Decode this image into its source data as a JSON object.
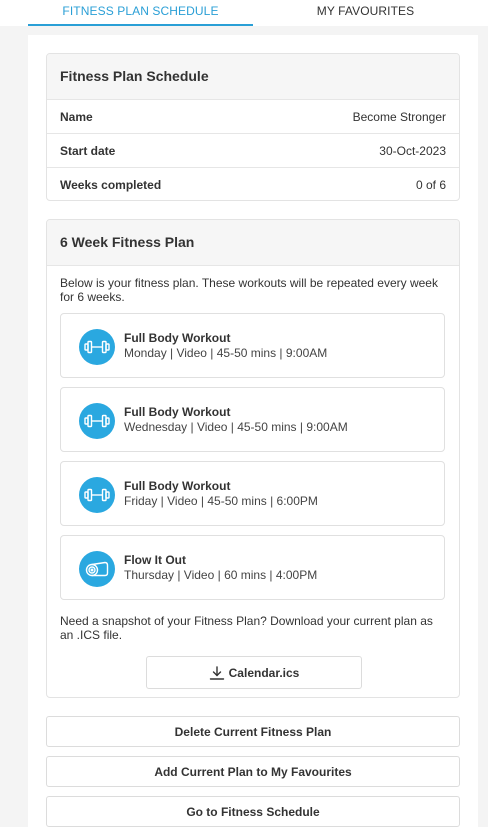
{
  "tabs": [
    {
      "label": "FITNESS PLAN SCHEDULE"
    },
    {
      "label": "MY FAVOURITES"
    }
  ],
  "schedule": {
    "title": "Fitness Plan Schedule",
    "rows": [
      {
        "key": "Name",
        "value": "Become Stronger"
      },
      {
        "key": "Start date",
        "value": "30-Oct-2023"
      },
      {
        "key": "Weeks completed",
        "value": "0 of 6"
      }
    ]
  },
  "plan": {
    "title": "6 Week Fitness Plan",
    "description": "Below is your fitness plan. These workouts will be repeated every week for 6 weeks.",
    "workouts": [
      {
        "title": "Full Body Workout",
        "details": "Monday | Video | 45-50 mins | 9:00AM",
        "icon": "dumbbell-icon"
      },
      {
        "title": "Full Body Workout",
        "details": "Wednesday | Video | 45-50 mins | 9:00AM",
        "icon": "dumbbell-icon"
      },
      {
        "title": "Full Body Workout",
        "details": "Friday | Video | 45-50 mins | 6:00PM",
        "icon": "dumbbell-icon"
      },
      {
        "title": "Flow It Out",
        "details": "Thursday | Video | 60 mins | 4:00PM",
        "icon": "yoga-mat-icon"
      }
    ],
    "snapshot_text": "Need a snapshot of your Fitness Plan? Download your current plan as an .ICS file.",
    "download_label": "Calendar.ics"
  },
  "actions": {
    "delete_label": "Delete Current Fitness Plan",
    "favourite_label": "Add Current Plan to My Favourites",
    "goto_label": "Go to Fitness Schedule"
  },
  "colors": {
    "accent": "#2a9fd6",
    "icon_bg": "#2aa8e0"
  }
}
